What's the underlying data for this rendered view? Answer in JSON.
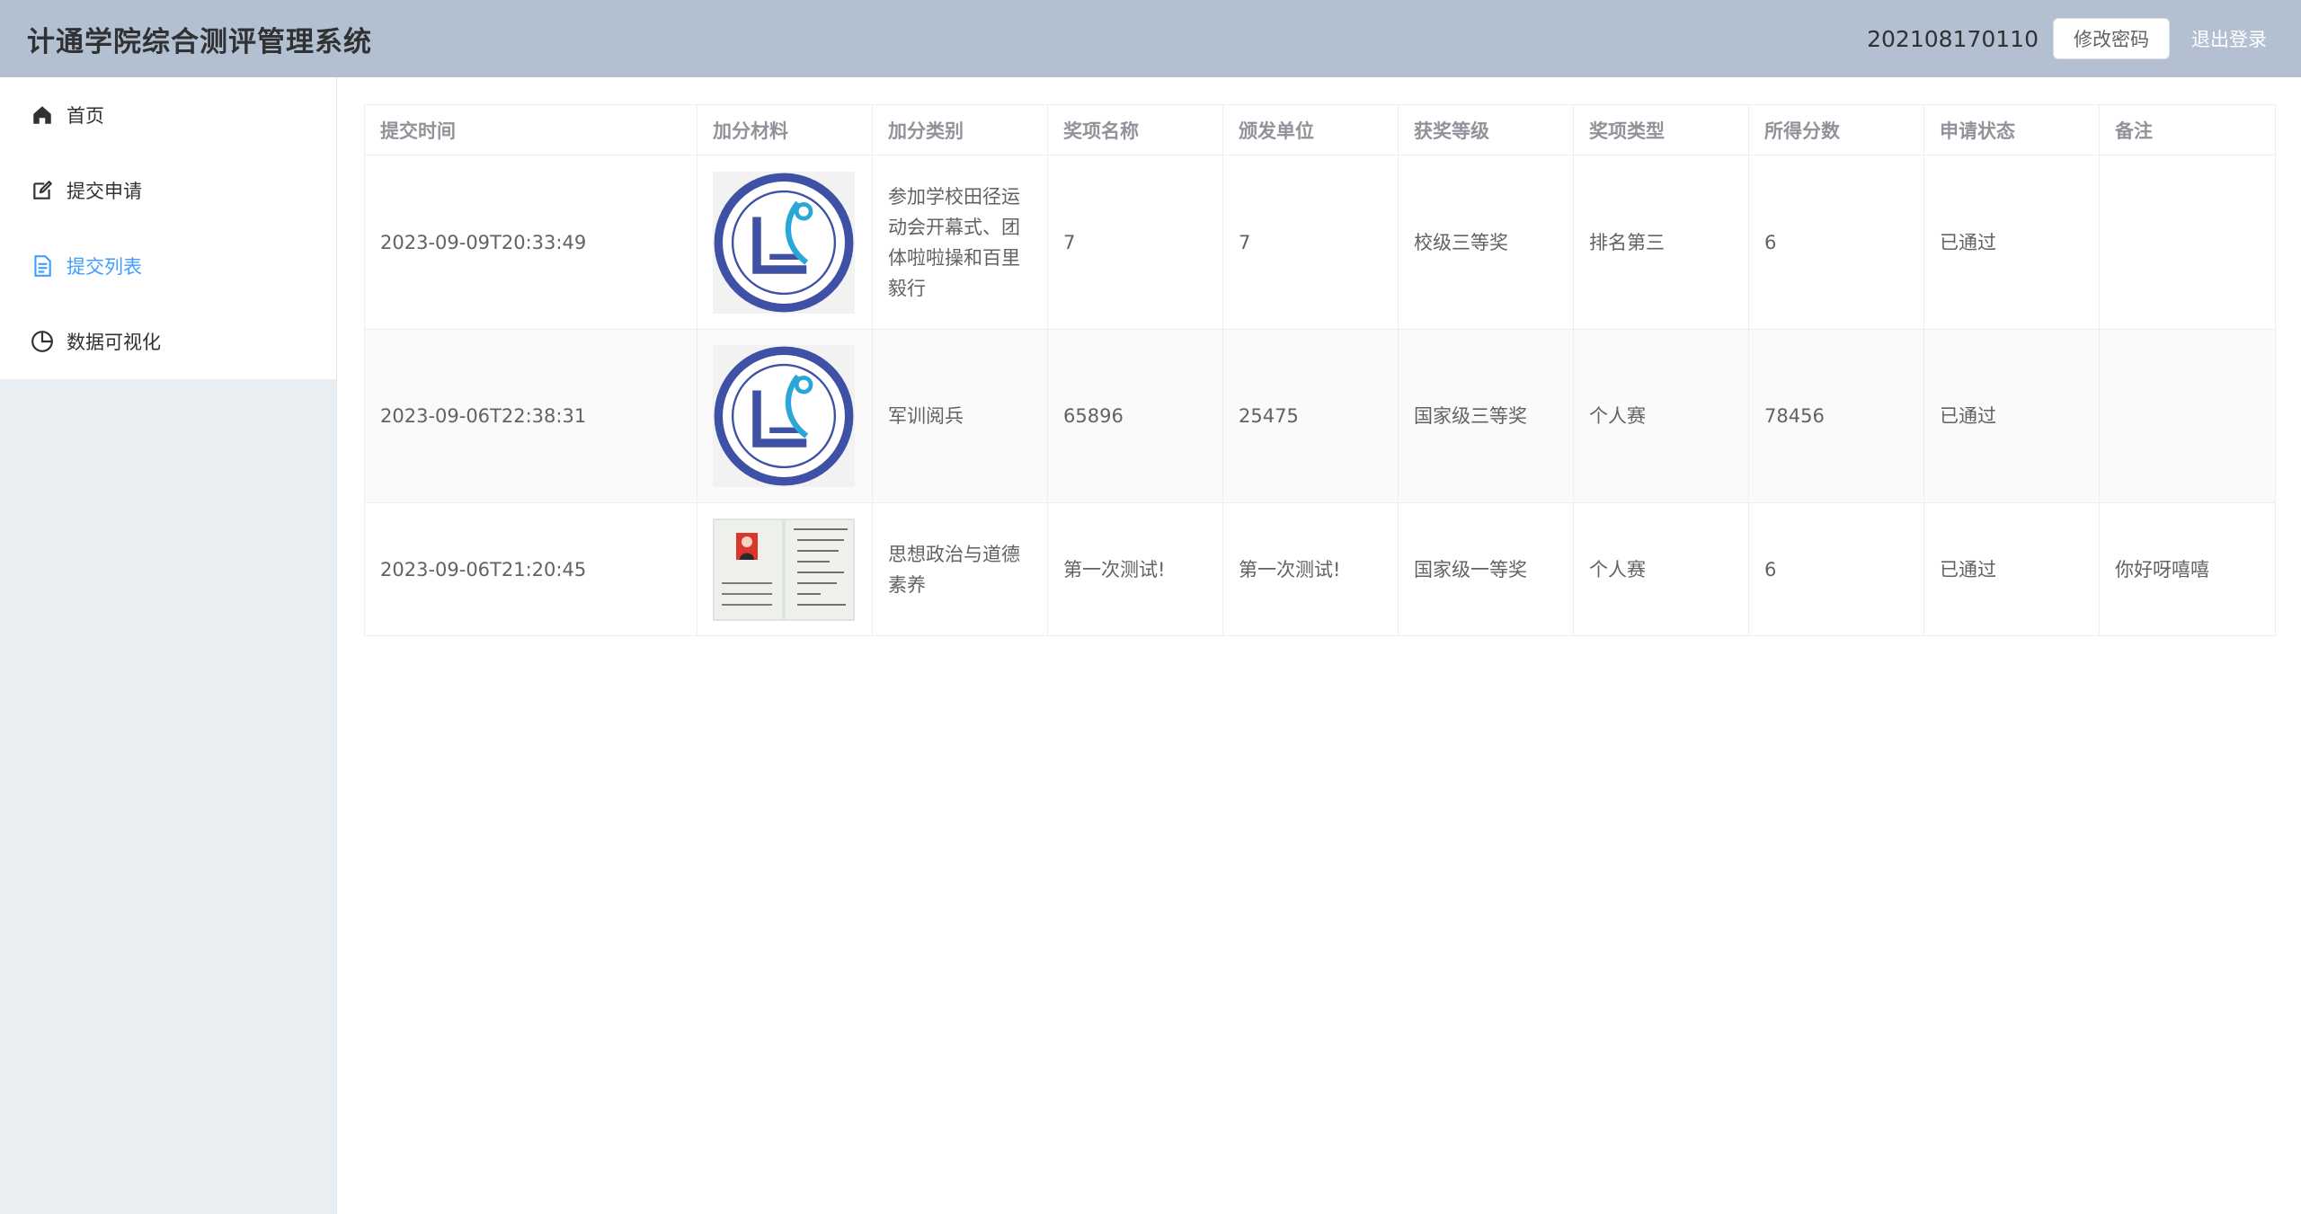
{
  "header": {
    "title": "计通学院综合测评管理系统",
    "user_id": "202108170110",
    "change_password": "修改密码",
    "logout": "退出登录"
  },
  "sidebar": {
    "items": [
      {
        "label": "首页",
        "icon": "home-icon",
        "active": false
      },
      {
        "label": "提交申请",
        "icon": "edit-icon",
        "active": false
      },
      {
        "label": "提交列表",
        "icon": "document-icon",
        "active": true
      },
      {
        "label": "数据可视化",
        "icon": "pie-chart-icon",
        "active": false
      }
    ]
  },
  "table": {
    "columns": [
      "提交时间",
      "加分材料",
      "加分类别",
      "奖项名称",
      "颁发单位",
      "获奖等级",
      "奖项类型",
      "所得分数",
      "申请状态",
      "备注"
    ],
    "rows": [
      {
        "time": "2023-09-09T20:33:49",
        "material": "logo-image",
        "category": "参加学校田径运动会开幕式、团体啦啦操和百里毅行",
        "award_name": "7",
        "issuer": "7",
        "level": "校级三等奖",
        "type": "排名第三",
        "score": "6",
        "status": "已通过",
        "remark": ""
      },
      {
        "time": "2023-09-06T22:38:31",
        "material": "logo-image",
        "category": "军训阅兵",
        "award_name": "65896",
        "issuer": "25475",
        "level": "国家级三等奖",
        "type": "个人赛",
        "score": "78456",
        "status": "已通过",
        "remark": ""
      },
      {
        "time": "2023-09-06T21:20:45",
        "material": "certificate-image",
        "category": "思想政治与道德素养",
        "award_name": "第一次测试!",
        "issuer": "第一次测试!",
        "level": "国家级一等奖",
        "type": "个人赛",
        "score": "6",
        "status": "已通过",
        "remark": "你好呀嘻嘻"
      }
    ]
  },
  "colors": {
    "header_bg": "#b3c0d1",
    "sidebar_bg": "#e9eef3",
    "active": "#409eff",
    "logo_blue": "#3f51a5",
    "logo_cyan": "#29a8d8"
  }
}
